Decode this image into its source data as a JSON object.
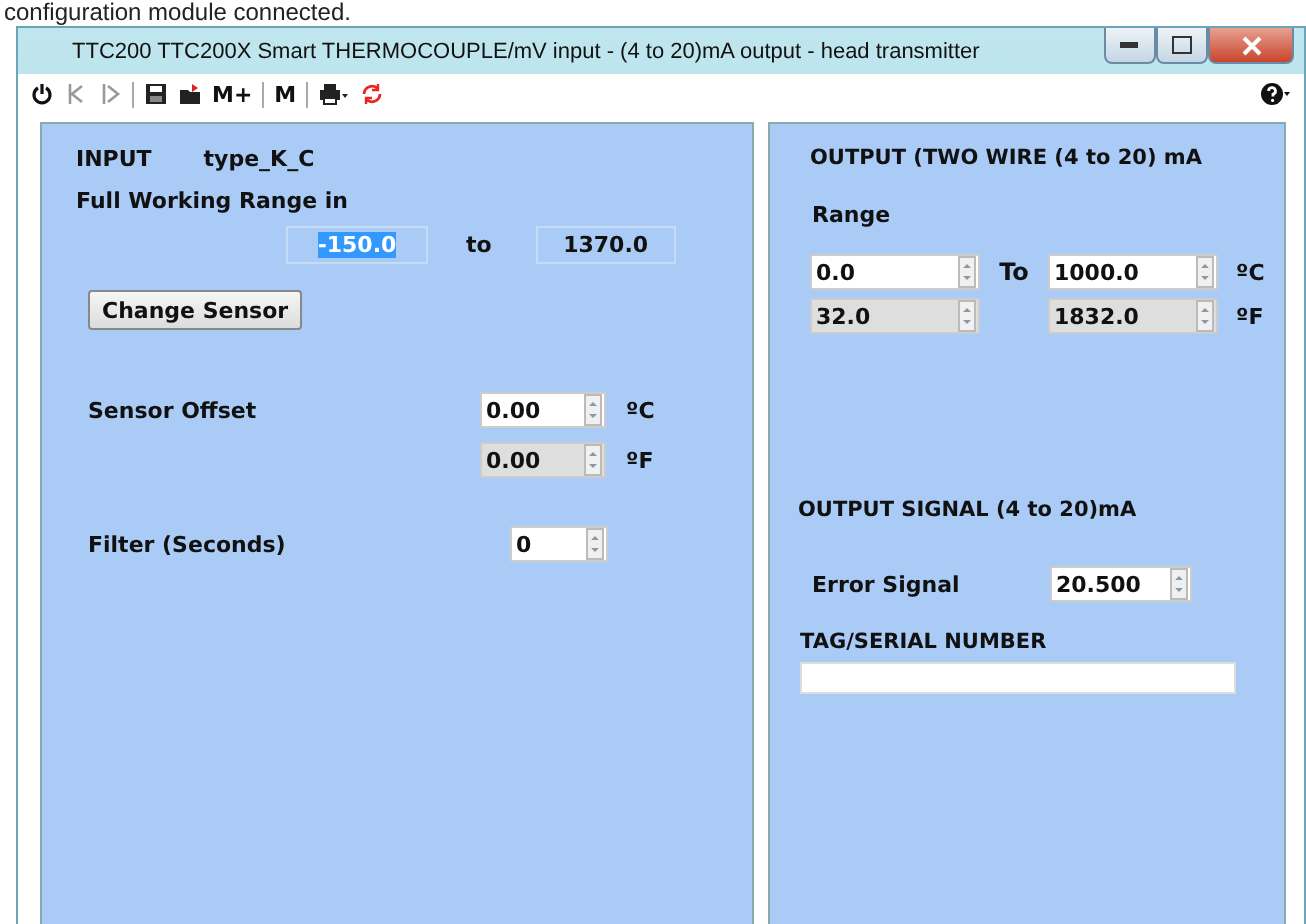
{
  "caption": "configuration module connected.",
  "window": {
    "title": "TTC200 TTC200X Smart THERMOCOUPLE/mV input - (4 to 20)mA output - head transmitter"
  },
  "toolbar": [
    {
      "kind": "power"
    },
    {
      "kind": "back"
    },
    {
      "kind": "forward"
    },
    {
      "kind": "sep"
    },
    {
      "kind": "save"
    },
    {
      "kind": "open"
    },
    {
      "kind": "text",
      "label": "M+"
    },
    {
      "kind": "sep"
    },
    {
      "kind": "text",
      "label": "M"
    },
    {
      "kind": "sep"
    },
    {
      "kind": "print"
    },
    {
      "kind": "refresh"
    }
  ],
  "input": {
    "heading": "INPUT",
    "sensor": "type_K_C",
    "range_label": "Full Working Range in",
    "range_from": {
      "value": "-150.0",
      "highlighted": true
    },
    "range_to_label": "to",
    "range_to": {
      "value": "1370.0",
      "highlighted": false
    },
    "change_button": "Change Sensor",
    "offset_label": "Sensor Offset",
    "offset_c": {
      "value": "0.00",
      "disabled": false,
      "unit": "ºC"
    },
    "offset_f": {
      "value": "0.00",
      "disabled": true,
      "unit": "ºF"
    },
    "filter_label": "Filter (Seconds)",
    "filter": {
      "value": "0",
      "disabled": false
    }
  },
  "output": {
    "heading": "OUTPUT (TWO WIRE (4 to 20) mA",
    "range_label": "Range",
    "to_label": "To",
    "rows": [
      {
        "from": {
          "value": "0.0",
          "disabled": false
        },
        "to": {
          "value": "1000.0",
          "disabled": false
        },
        "unit": "ºC"
      },
      {
        "from": {
          "value": "32.0",
          "disabled": true
        },
        "to": {
          "value": "1832.0",
          "disabled": true
        },
        "unit": "ºF"
      }
    ],
    "signal_heading": "OUTPUT SIGNAL (4 to 20)mA",
    "error_label": "Error Signal",
    "error": {
      "value": "20.500",
      "disabled": false
    },
    "tag_label": "TAG/SERIAL  NUMBER"
  }
}
